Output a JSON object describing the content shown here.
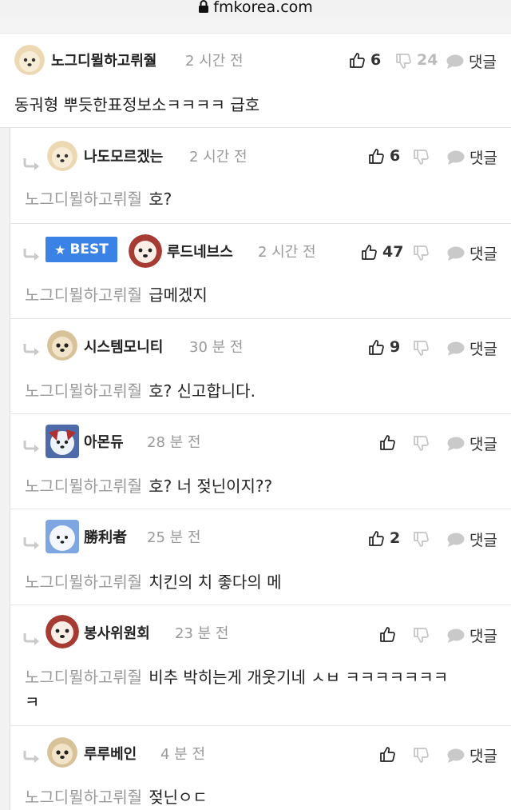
{
  "browser": {
    "url": "fmkorea.com"
  },
  "labels": {
    "reply": "댓글",
    "best": "BEST"
  },
  "comments": [
    {
      "name": "노그디뮐하고뤼줠",
      "time": "2 시간 전",
      "up": "6",
      "down": "24",
      "text": "동궈형 뿌듯한표정보소ㅋㅋㅋㅋ 급호"
    },
    {
      "name": "나도모르겠는",
      "time": "2 시간 전",
      "up": "6",
      "mention": "노그디뮐하고뤼줠",
      "text": "호?"
    },
    {
      "name": "루드네브스",
      "time": "2 시간 전",
      "up": "47",
      "mention": "노그디뮐하고뤼줠",
      "text": "급메겠지"
    },
    {
      "name": "시스템모니티",
      "time": "30 분 전",
      "up": "9",
      "mention": "노그디뮐하고뤼줠",
      "text": "호? 신고합니다."
    },
    {
      "name": "아몬듀",
      "time": "28 분 전",
      "up": "",
      "mention": "노그디뮐하고뤼줠",
      "text": "호? 너 젖닌이지??"
    },
    {
      "name": "勝利者",
      "time": "25 분 전",
      "up": "2",
      "mention": "노그디뮐하고뤼줠",
      "text": "치킨의 치 좋다의 메"
    },
    {
      "name": "봉사위원회",
      "time": "23 분 전",
      "up": "",
      "mention": "노그디뮐하고뤼줠",
      "text": "비추 박히는게 개웃기네 ㅅㅂ ㅋㅋㅋㅋㅋㅋㅋ",
      "text2": "ㅋ"
    },
    {
      "name": "루루베인",
      "time": "4 분 전",
      "up": "",
      "mention": "노그디뮐하고뤼줠",
      "text": "젖닌ㅇㄷ"
    }
  ],
  "colors": {
    "accent": "#3b82e6",
    "muted": "#999999",
    "divider": "#e5e5e5"
  }
}
